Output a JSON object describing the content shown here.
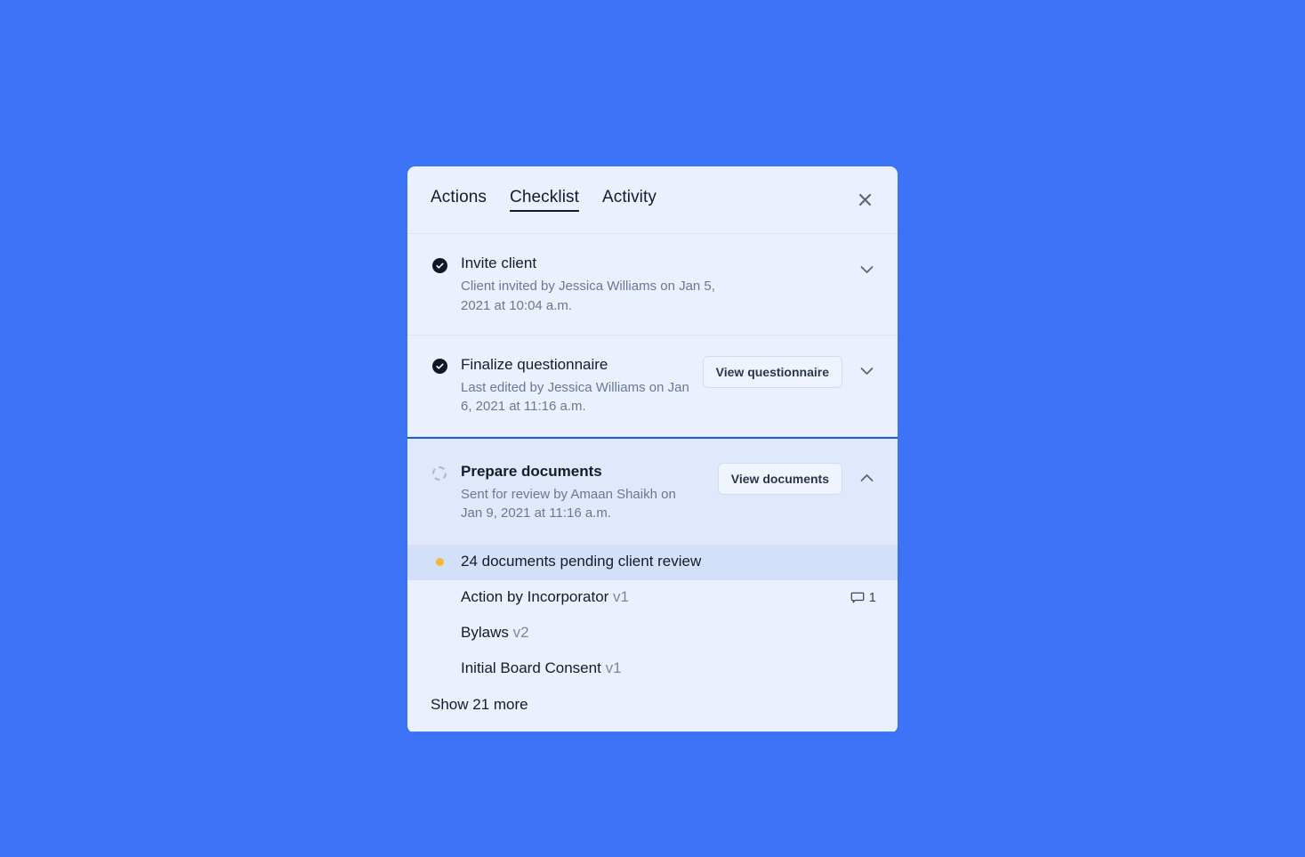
{
  "page": {
    "background_color": "#3d74f7",
    "card_background": "#eaf0fd",
    "accent_color": "#1c5ed6",
    "pending_dot_color": "#f2b92f"
  },
  "header": {
    "tabs": [
      {
        "label": "Actions",
        "active": false
      },
      {
        "label": "Checklist",
        "active": true
      },
      {
        "label": "Activity",
        "active": false
      }
    ],
    "close_icon": "close-icon"
  },
  "checklist": [
    {
      "status_icon": "check-circle-icon",
      "status": "complete",
      "title": "Invite client",
      "meta": "Client invited by Jessica Williams on Jan 5, 2021 at 10:04 a.m.",
      "button": null,
      "chevron_icon": "chevron-down-icon",
      "expanded": false
    },
    {
      "status_icon": "check-circle-icon",
      "status": "complete",
      "title": "Finalize questionnaire",
      "meta": "Last edited by Jessica Williams on Jan 6, 2021 at 11:16 a.m.",
      "button": "View questionnaire",
      "chevron_icon": "chevron-down-icon",
      "expanded": false
    },
    {
      "status_icon": "dashed-circle-icon",
      "status": "in-progress",
      "title": "Prepare documents",
      "meta": "Sent for review by Amaan Shaikh on Jan 9, 2021 at 11:16 a.m.",
      "button": "View documents",
      "chevron_icon": "chevron-up-icon",
      "expanded": true
    }
  ],
  "documents_section": {
    "summary": {
      "bullet_icon": "pending-dot-icon",
      "label": "24 documents pending client review"
    },
    "documents": [
      {
        "name": "Action by Incorporator",
        "version": "v1",
        "comment_icon": "comment-icon",
        "comment_count": "1"
      },
      {
        "name": "Bylaws",
        "version": "v2",
        "comment_icon": null,
        "comment_count": null
      },
      {
        "name": "Initial Board Consent",
        "version": "v1",
        "comment_icon": null,
        "comment_count": null
      }
    ],
    "show_more_label": "Show 21 more"
  }
}
